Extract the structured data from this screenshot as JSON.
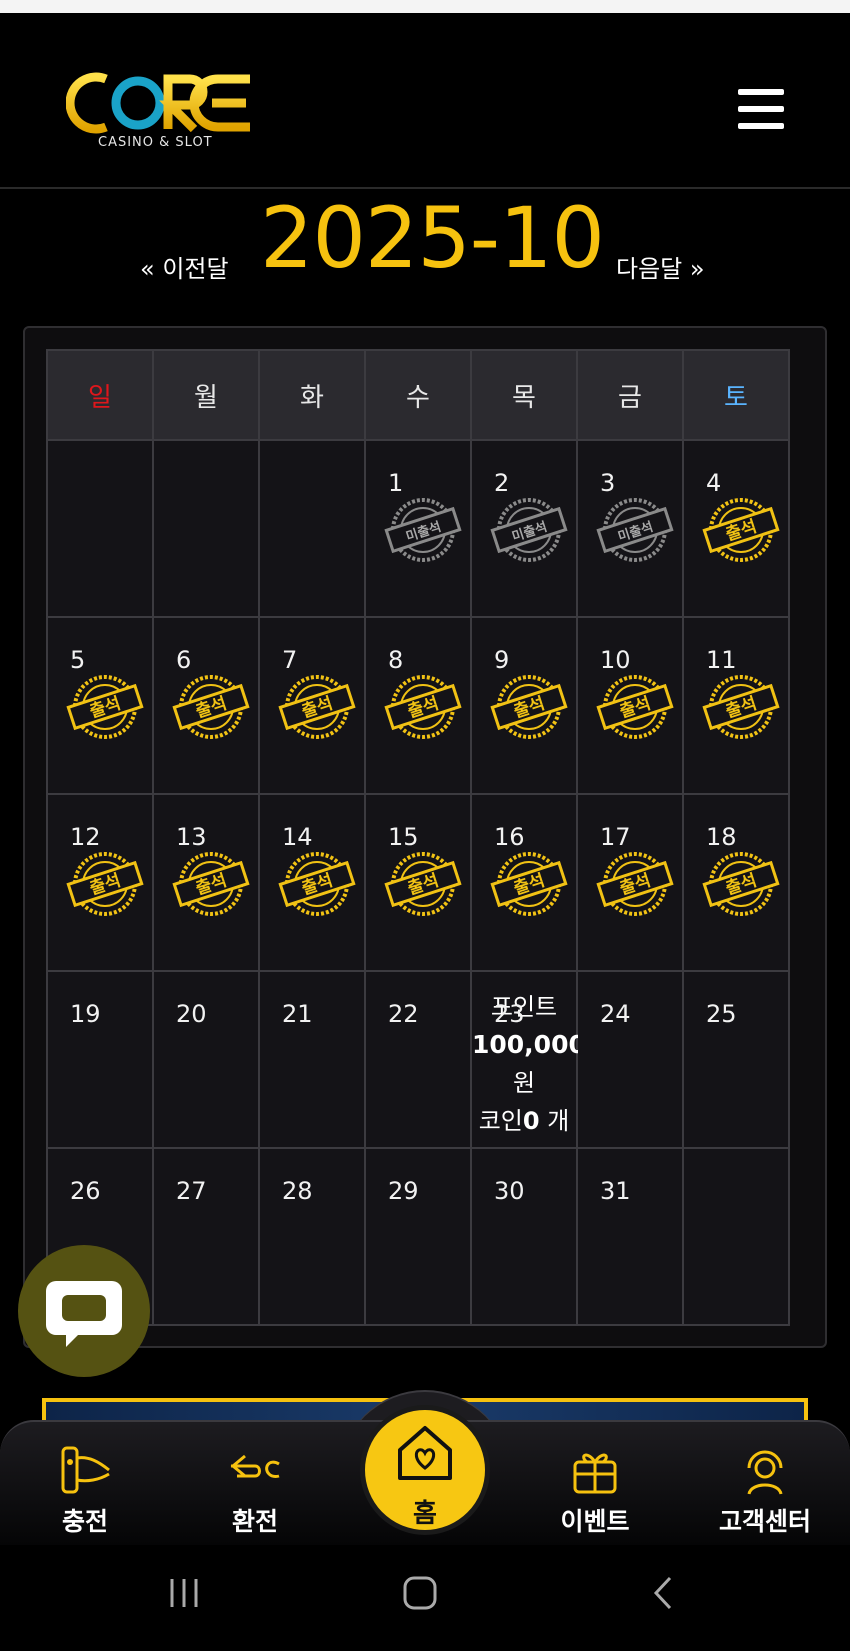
{
  "brand": {
    "logo_text": "CORE",
    "logo_sub": "CASINO & SLOT",
    "accent": "#f6c20f"
  },
  "header": {
    "menu_icon": "hamburger-menu-icon"
  },
  "calendar": {
    "prev_label": "« 이전달",
    "next_label": "다음달 »",
    "month": "2025-10",
    "weekdays": [
      "일",
      "월",
      "화",
      "수",
      "목",
      "금",
      "토"
    ],
    "stamp_attended": "출석",
    "stamp_absent": "미출석",
    "days": [
      {
        "d": "1",
        "stamp": "absent"
      },
      {
        "d": "2",
        "stamp": "absent"
      },
      {
        "d": "3",
        "stamp": "absent"
      },
      {
        "d": "4",
        "stamp": "attended"
      },
      {
        "d": "5",
        "stamp": "attended"
      },
      {
        "d": "6",
        "stamp": "attended"
      },
      {
        "d": "7",
        "stamp": "attended"
      },
      {
        "d": "8",
        "stamp": "attended"
      },
      {
        "d": "9",
        "stamp": "attended"
      },
      {
        "d": "10",
        "stamp": "attended"
      },
      {
        "d": "11",
        "stamp": "attended"
      },
      {
        "d": "12",
        "stamp": "attended"
      },
      {
        "d": "13",
        "stamp": "attended"
      },
      {
        "d": "14",
        "stamp": "attended"
      },
      {
        "d": "15",
        "stamp": "attended"
      },
      {
        "d": "16",
        "stamp": "attended"
      },
      {
        "d": "17",
        "stamp": "attended"
      },
      {
        "d": "18",
        "stamp": "attended"
      },
      {
        "d": "19",
        "stamp": ""
      },
      {
        "d": "20",
        "stamp": ""
      },
      {
        "d": "21",
        "stamp": ""
      },
      {
        "d": "22",
        "stamp": ""
      },
      {
        "d": "23",
        "stamp": "",
        "points": true
      },
      {
        "d": "24",
        "stamp": ""
      },
      {
        "d": "25",
        "stamp": ""
      },
      {
        "d": "26",
        "stamp": ""
      },
      {
        "d": "27",
        "stamp": ""
      },
      {
        "d": "28",
        "stamp": ""
      },
      {
        "d": "29",
        "stamp": ""
      },
      {
        "d": "30",
        "stamp": ""
      },
      {
        "d": "31",
        "stamp": ""
      }
    ],
    "today_points": {
      "line1": "포인트",
      "amount": "100,000",
      "unit": "원",
      "coin_label": "코인",
      "coin_value": "0",
      "coin_unit": "개"
    }
  },
  "chat": {
    "icon": "chat-bubble-icon"
  },
  "bottom_nav": [
    {
      "label": "충전",
      "icon": "deposit-icon"
    },
    {
      "label": "환전",
      "icon": "exchange-icon"
    },
    {
      "label": "홈",
      "icon": "home-heart-icon"
    },
    {
      "label": "이벤트",
      "icon": "gift-icon"
    },
    {
      "label": "고객센터",
      "icon": "support-icon"
    }
  ]
}
